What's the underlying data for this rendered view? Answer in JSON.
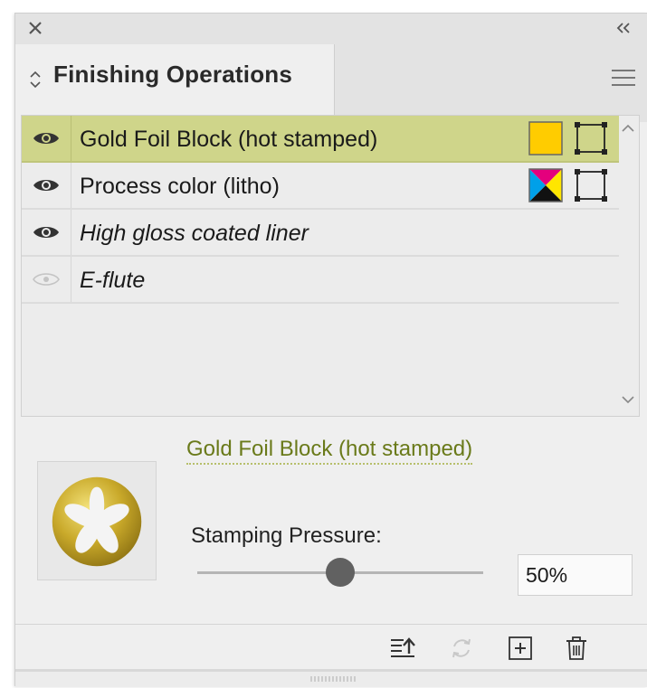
{
  "panel": {
    "tab_label": "Finishing Operations",
    "icons": {
      "close": "close-icon",
      "collapse": "double-chevron-left-icon",
      "tab_sort": "up-down-arrows-icon",
      "panel_menu": "hamburger-menu-icon"
    }
  },
  "operations": [
    {
      "name": "Gold Foil Block (hot stamped)",
      "visible": true,
      "selected": true,
      "italic": false,
      "fill": "gold-swatch",
      "stroke": "stroke-box"
    },
    {
      "name": "Process color (litho)",
      "visible": true,
      "selected": false,
      "italic": false,
      "fill": "cmyk-swatch",
      "stroke": "stroke-box"
    },
    {
      "name": "High gloss coated liner",
      "visible": true,
      "selected": false,
      "italic": true
    },
    {
      "name": "E-flute",
      "visible": false,
      "selected": false,
      "italic": true
    }
  ],
  "detail": {
    "title": "Gold Foil Block (hot stamped)",
    "pressure_label": "Stamping Pressure:",
    "pressure_value": "50%",
    "pressure_fraction": 0.5
  },
  "toolbar": {
    "icons": [
      "move-to-top-icon",
      "refresh-icon",
      "add-icon",
      "trash-icon"
    ]
  },
  "colors": {
    "selected_row": "#cfd58a",
    "gold": "#ffcc00",
    "accent_text": "#6a7a1a"
  }
}
